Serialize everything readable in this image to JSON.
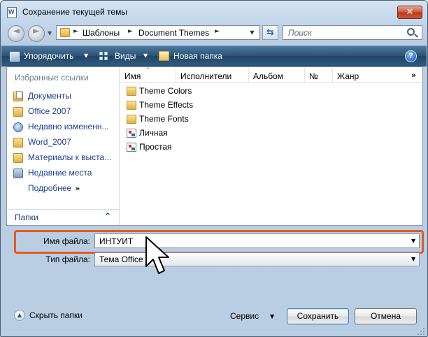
{
  "window": {
    "title": "Сохранение текущей темы"
  },
  "address": {
    "crumbs": [
      "Шаблоны",
      "Document Themes"
    ],
    "search_placeholder": "Поиск"
  },
  "toolbar": {
    "organize_label": "Упорядочить",
    "views_label": "Виды",
    "new_folder_label": "Новая папка",
    "help_glyph": "?"
  },
  "nav": {
    "favorites_header": "Избранные ссылки",
    "items": [
      {
        "label": "Документы",
        "icon": "documents-folder-icon"
      },
      {
        "label": "Office 2007",
        "icon": "folder-icon"
      },
      {
        "label": "Недавно измененн...",
        "icon": "recent-icon"
      },
      {
        "label": "Word_2007",
        "icon": "folder-icon"
      },
      {
        "label": "Материалы к выста...",
        "icon": "folder-icon"
      },
      {
        "label": "Недавние места",
        "icon": "places-icon"
      }
    ],
    "more_label": "Подробнее",
    "folders_label": "Папки"
  },
  "columns": [
    "Имя",
    "Исполнители",
    "Альбом",
    "№",
    "Жанр"
  ],
  "files": [
    {
      "name": "Theme Colors",
      "type": "folder"
    },
    {
      "name": "Theme Effects",
      "type": "folder"
    },
    {
      "name": "Theme Fonts",
      "type": "folder"
    },
    {
      "name": "Личная",
      "type": "theme"
    },
    {
      "name": "Простая",
      "type": "theme"
    }
  ],
  "form": {
    "filename_label": "Имя файла:",
    "filename_value": "ИНТУИТ",
    "filetype_label": "Тип файла:",
    "filetype_value": "Тема Office"
  },
  "footer": {
    "hide_folders_label": "Скрыть папки",
    "service_label": "Сервис",
    "save_label": "Сохранить",
    "cancel_label": "Отмена"
  },
  "colors": {
    "highlight": "#e55a1f",
    "toolbar": "#2a5276",
    "link": "#1a3e8c"
  }
}
